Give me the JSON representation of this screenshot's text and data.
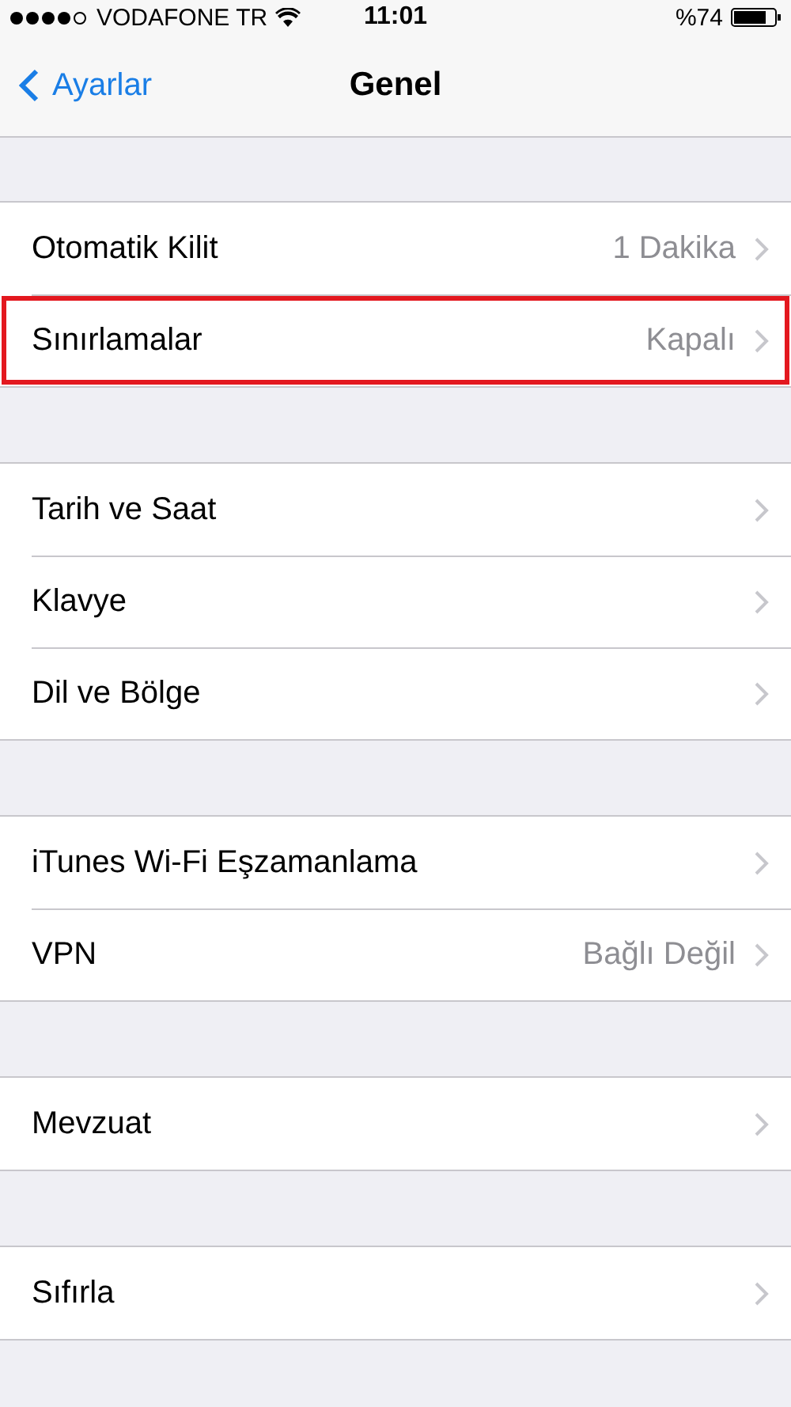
{
  "status_bar": {
    "carrier": "VODAFONE TR",
    "time": "11:01",
    "battery_percent": "%74"
  },
  "nav": {
    "back": "Ayarlar",
    "title": "Genel"
  },
  "groups": [
    {
      "rows": [
        {
          "label": "Otomatik Kilit",
          "value": "1 Dakika",
          "highlighted": false
        },
        {
          "label": "Sınırlamalar",
          "value": "Kapalı",
          "highlighted": true
        }
      ]
    },
    {
      "rows": [
        {
          "label": "Tarih ve Saat",
          "highlighted": false
        },
        {
          "label": "Klavye",
          "highlighted": false
        },
        {
          "label": "Dil ve Bölge",
          "highlighted": false
        }
      ]
    },
    {
      "rows": [
        {
          "label": "iTunes Wi-Fi Eşzamanlama",
          "highlighted": false
        },
        {
          "label": "VPN",
          "value": "Bağlı Değil",
          "highlighted": false
        }
      ]
    },
    {
      "rows": [
        {
          "label": "Mevzuat",
          "highlighted": false
        }
      ]
    },
    {
      "rows": [
        {
          "label": "Sıfırla",
          "highlighted": false
        }
      ]
    }
  ]
}
